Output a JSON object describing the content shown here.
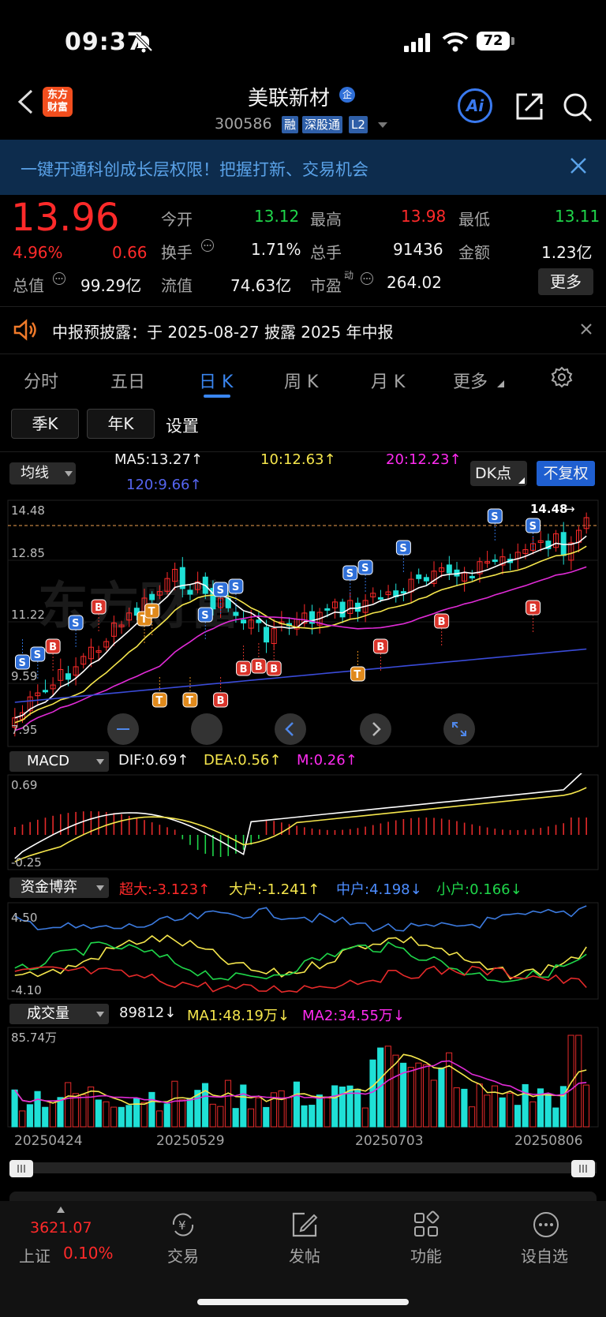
{
  "status_bar": {
    "time": "09:37",
    "battery": "72"
  },
  "header": {
    "logo_line1": "东方",
    "logo_line2": "财富",
    "title": "美联新材",
    "title_badge": "企",
    "code": "300586",
    "tags": [
      "融",
      "深股通",
      "L2"
    ],
    "ai_label": "Ai"
  },
  "banner": {
    "text": "一键开通科创成长层权限！把握打新、交易机会"
  },
  "quote": {
    "price": "13.96",
    "change_pct": "4.96%",
    "change": "0.66",
    "open_label": "今开",
    "open": "13.12",
    "high_label": "最高",
    "high": "13.98",
    "low_label": "最低",
    "low": "13.11",
    "turnover_label": "换手",
    "turnover": "1.71%",
    "volume_label": "总手",
    "volume": "91436",
    "amount_label": "金额",
    "amount": "1.23亿",
    "total_cap_label": "总值",
    "total_cap": "99.29亿",
    "float_cap_label": "流值",
    "float_cap": "74.63亿",
    "pe_label": "市盈",
    "pe_sup": "动",
    "pe": "264.02",
    "more_label": "更多"
  },
  "notice": {
    "text": "中报预披露：于 2025-08-27 披露 2025 年中报"
  },
  "tabs": {
    "items": [
      "分时",
      "五日",
      "日 K",
      "周 K",
      "月 K",
      "更多"
    ],
    "active": "日 K",
    "sub": [
      "季K",
      "年K",
      "设置"
    ]
  },
  "ma_bar": {
    "selector": "均线",
    "ma5": "MA5:13.27",
    "ma10": "10:12.63",
    "ma20": "20:12.23",
    "ma120": "120:9.66",
    "dk_label": "DK点",
    "adjust_label": "不复权",
    "arrow": "↑"
  },
  "kchart": {
    "y_labels": [
      "14.48",
      "12.85",
      "11.22",
      "9.59",
      "7.95"
    ],
    "max_marker": "14.48",
    "signal_S": "S",
    "signal_B": "B",
    "signal_T": "T",
    "colors": {
      "up": "#ff2a2a",
      "down": "#1fe0d6",
      "ma5": "#ffffff",
      "ma10": "#f5e64c",
      "ma20": "#e02bd6",
      "ma120": "#3a4bd8"
    }
  },
  "macd": {
    "selector": "MACD",
    "dif": "DIF:0.69",
    "dea": "DEA:0.56",
    "m": "M:0.26",
    "top": "0.69",
    "bottom": "-0.25"
  },
  "capital": {
    "selector": "资金博弈",
    "super": "超大:-3.123",
    "large": "大户:-1.241",
    "mid": "中户:4.198",
    "small": "小户:0.166",
    "arrow_up": "↑",
    "arrow_down": "↓",
    "top": "4.50",
    "bottom": "-4.10"
  },
  "volume": {
    "selector": "成交量",
    "value": "89812",
    "ma1": "MA1:48.19万",
    "ma2": "MA2:34.55万",
    "arrow_down": "↓",
    "top": "85.74万",
    "dates": [
      "20250424",
      "20250529",
      "20250703",
      "20250806"
    ]
  },
  "bottom_nav": {
    "index_value": "3621.07",
    "index_name": "上证",
    "index_pct": "0.10%",
    "items": [
      "交易",
      "发帖",
      "功能",
      "设自选"
    ]
  }
}
